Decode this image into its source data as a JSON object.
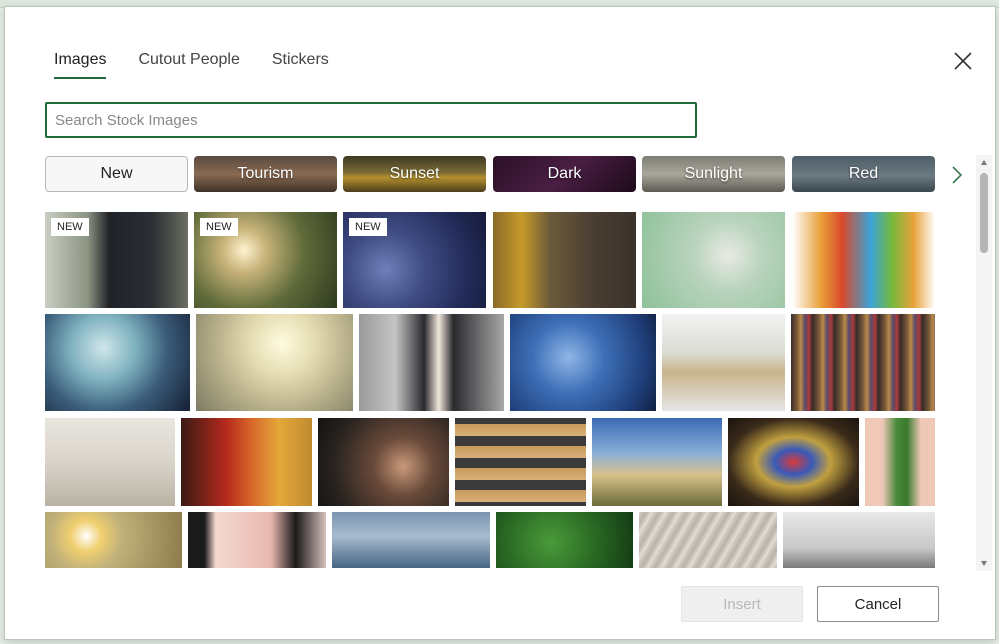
{
  "tabs": [
    {
      "label": "Images",
      "active": true
    },
    {
      "label": "Cutout People",
      "active": false
    },
    {
      "label": "Stickers",
      "active": false
    }
  ],
  "search": {
    "placeholder": "Search Stock Images",
    "value": ""
  },
  "categories": [
    {
      "label": "New",
      "style": "plain"
    },
    {
      "label": "Tourism",
      "style": "image"
    },
    {
      "label": "Sunset",
      "style": "image"
    },
    {
      "label": "Dark",
      "style": "image"
    },
    {
      "label": "Sunlight",
      "style": "image"
    },
    {
      "label": "Red",
      "style": "image"
    }
  ],
  "badges": {
    "new": "NEW"
  },
  "buttons": {
    "insert": "Insert",
    "cancel": "Cancel"
  },
  "icons": {
    "close": "close-icon",
    "next": "chevron-right-icon",
    "scroll_up": "scroll-up-icon",
    "scroll_down": "scroll-down-icon"
  },
  "colors": {
    "accent": "#1f6b3a"
  }
}
